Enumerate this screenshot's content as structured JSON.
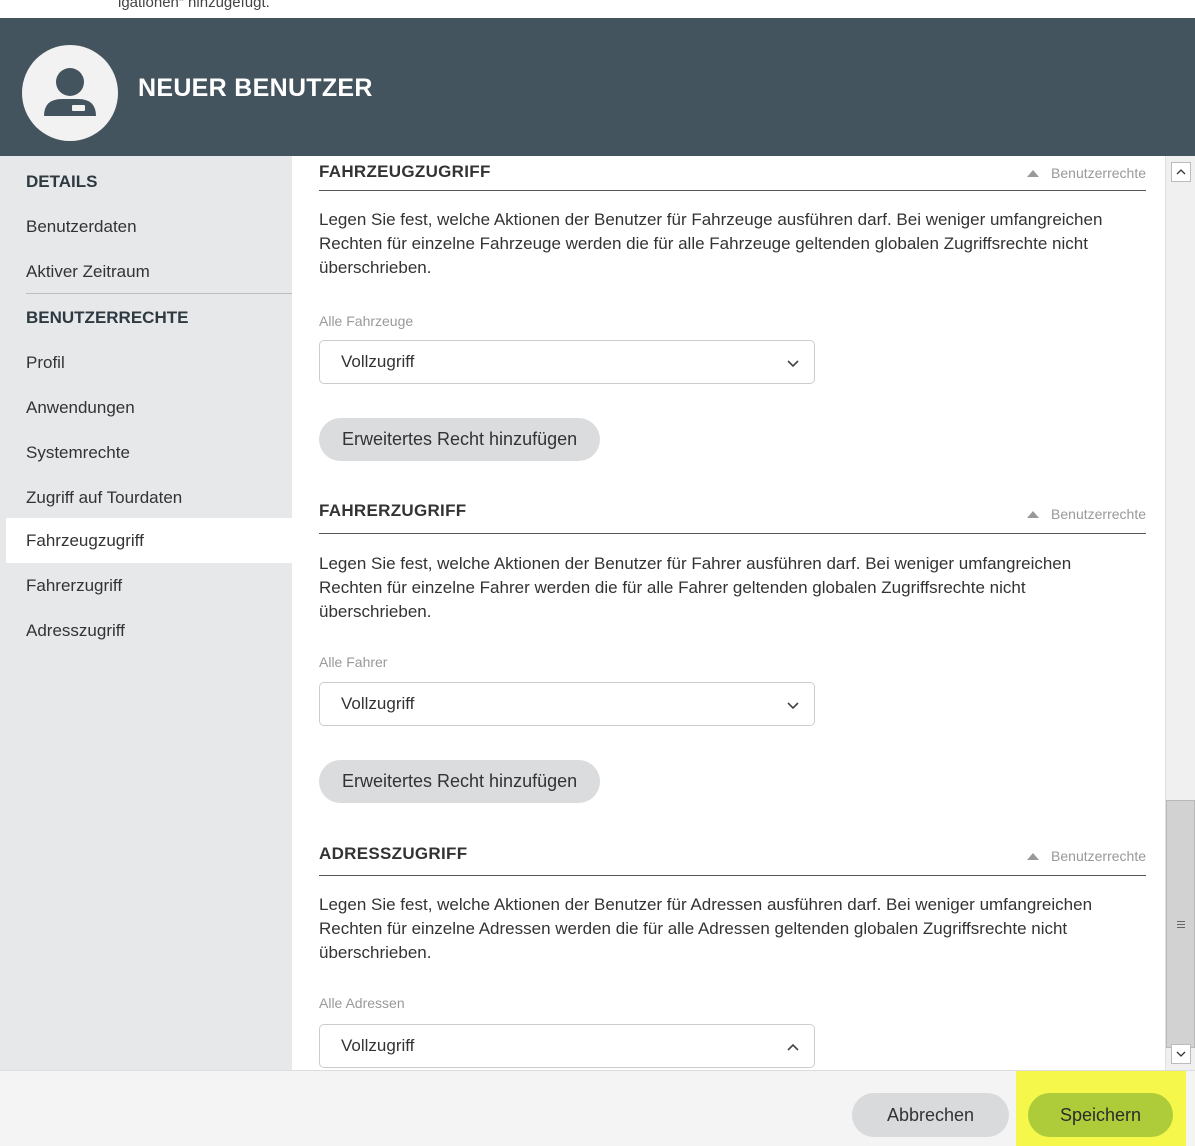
{
  "caption": "igationen“ hinzugefügt.",
  "header": {
    "title": "NEUER BENUTZER",
    "avatar_icon": "user-avatar-icon"
  },
  "sidebar": {
    "details_heading": "DETAILS",
    "details_items": [
      "Benutzerdaten",
      "Aktiver Zeitraum"
    ],
    "rights_heading": "BENUTZERRECHTE",
    "rights_items": [
      "Profil",
      "Anwendungen",
      "Systemrechte",
      "Zugriff auf Tourdaten",
      "Fahrzeugzugriff",
      "Fahrerzugriff",
      "Adresszugriff"
    ],
    "active_item": "Fahrzeugzugriff"
  },
  "sections": [
    {
      "title": "FAHRZEUGZUGRIFF",
      "link": "Benutzerrechte",
      "description": "Legen Sie fest, welche Aktionen der Benutzer für Fahrzeuge ausführen darf. Bei weniger umfangreichen Rechten für einzelne Fahrzeuge werden die für alle Fahrzeuge geltenden globalen Zugriffsrechte nicht überschrieben.",
      "field_label": "Alle Fahrzeuge",
      "select_value": "Vollzugriff",
      "select_open": false,
      "button": "Erweitertes Recht hinzufügen"
    },
    {
      "title": "FAHRERZUGRIFF",
      "link": "Benutzerrechte",
      "description": "Legen Sie fest, welche Aktionen der Benutzer für Fahrer ausführen darf. Bei weniger umfangreichen Rechten für einzelne Fahrer werden die für alle Fahrer geltenden globalen Zugriffsrechte nicht überschrieben.",
      "field_label": "Alle Fahrer",
      "select_value": "Vollzugriff",
      "select_open": false,
      "button": "Erweitertes Recht hinzufügen"
    },
    {
      "title": "ADRESSZUGRIFF",
      "link": "Benutzerrechte",
      "description": "Legen Sie fest, welche Aktionen der Benutzer für Adressen ausführen darf. Bei weniger umfangreichen Rechten für einzelne Adressen werden die für alle Adressen geltenden globalen Zugriffsrechte nicht überschrieben.",
      "field_label": "Alle Adressen",
      "select_value": "Vollzugriff",
      "select_open": true
    }
  ],
  "footer": {
    "cancel_label": "Abbrechen",
    "save_label": "Speichern"
  },
  "colors": {
    "header_bg": "#44545e",
    "sidebar_bg": "#e6e8ea",
    "save_button": "#aecc3a",
    "highlight": "#f5f74a"
  }
}
